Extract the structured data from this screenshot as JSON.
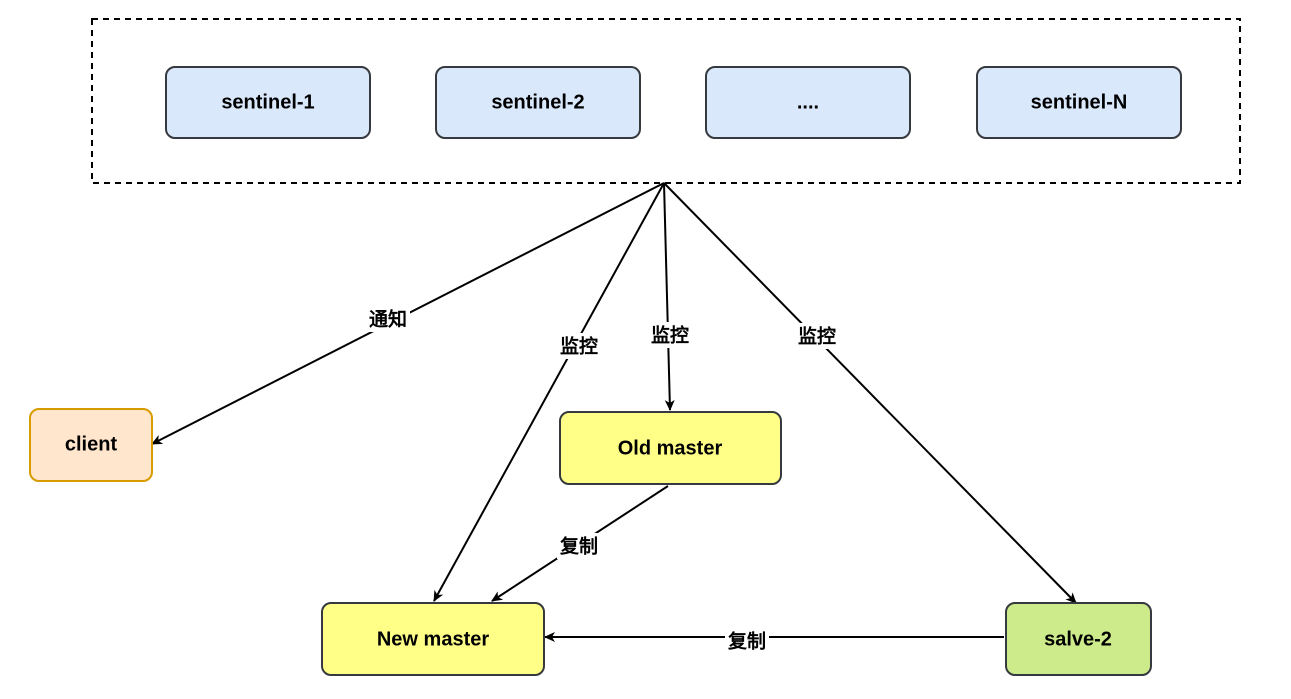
{
  "sentinel_group": {
    "nodes": [
      {
        "label": "sentinel-1"
      },
      {
        "label": "sentinel-2"
      },
      {
        "label": "...."
      },
      {
        "label": "sentinel-N"
      }
    ]
  },
  "nodes": {
    "client": {
      "label": "client"
    },
    "old_master": {
      "label": "Old master"
    },
    "new_master": {
      "label": "New master"
    },
    "slave2": {
      "label": "salve-2"
    }
  },
  "edges": {
    "notify_client": {
      "label": "通知"
    },
    "monitor_new_master": {
      "label": "监控"
    },
    "monitor_old_master": {
      "label": "监控"
    },
    "monitor_slave2": {
      "label": "监控"
    },
    "replicate_old_to_new": {
      "label": "复制"
    },
    "replicate_slave2_to_new": {
      "label": "复制"
    }
  },
  "colors": {
    "sentinel_fill": "#dae8fc",
    "master_fill": "#ffff88",
    "client_fill": "#ffe6cc",
    "client_stroke": "#d79b00",
    "slave_fill": "#cdeb8b",
    "stroke": "#36393d",
    "edge": "#000000"
  }
}
